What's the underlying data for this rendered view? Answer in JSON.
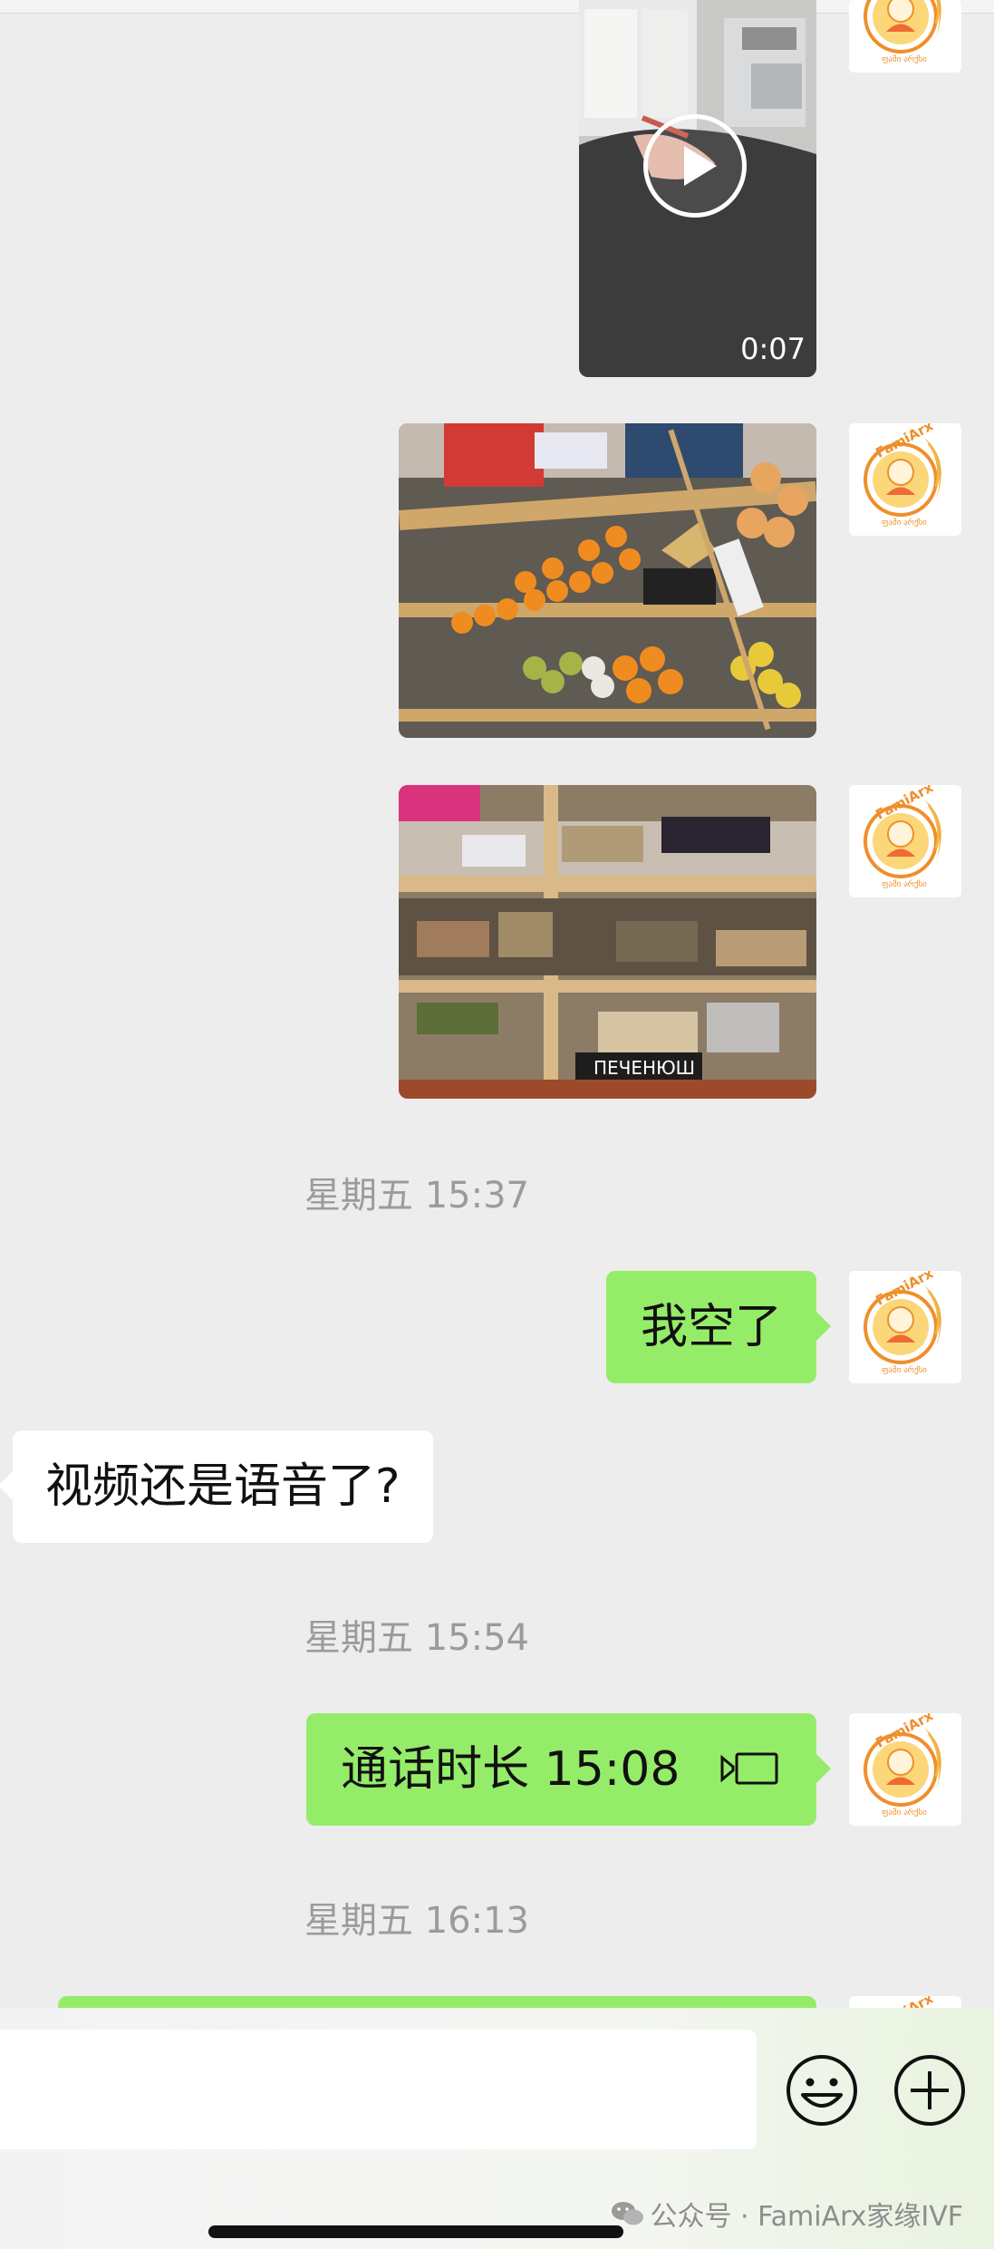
{
  "avatar": {
    "brand": "FamiArx",
    "subtitle": "ფამი არქსი"
  },
  "video": {
    "duration": "0:07"
  },
  "messages": {
    "t1": "星期五 15:37",
    "m1": "我空了",
    "m2": "视频还是语音了?",
    "t2": "星期五 15:54",
    "m3_prefix": "通话时长",
    "m3_time": "15:08",
    "t3": "星期五 16:13"
  },
  "input": {
    "value": ""
  },
  "watermark": {
    "text": "公众号 · FamiArx家缘IVF"
  },
  "colors": {
    "bubble_out": "#95ec69",
    "bubble_in": "#ffffff",
    "background": "#ededed",
    "brand_orange": "#f08a24"
  }
}
